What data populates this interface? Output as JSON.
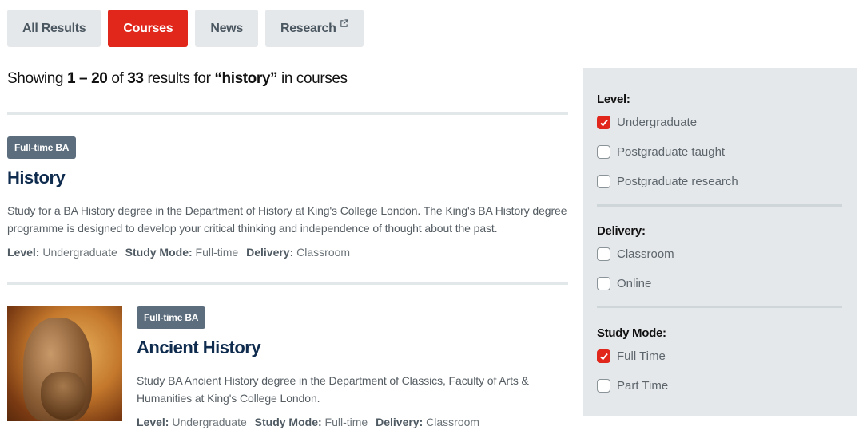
{
  "tabs": [
    {
      "label": "All Results",
      "active": false
    },
    {
      "label": "Courses",
      "active": true
    },
    {
      "label": "News",
      "active": false
    },
    {
      "label": "Research",
      "active": false,
      "icon": "external-link-icon"
    }
  ],
  "summary": {
    "prefix": "Showing",
    "range": "1 – 20",
    "of": "of",
    "total": "33",
    "results_for": "results for",
    "query": "“history”",
    "suffix": "in courses"
  },
  "results": [
    {
      "badge": "Full-time BA",
      "title": "History",
      "description": "Study for a BA History degree in the Department of History at King's College London. The King's BA History degree programme is designed to develop your critical thinking and independence of thought about the past.",
      "meta": [
        {
          "key": "Level:",
          "value": "Undergraduate"
        },
        {
          "key": "Study Mode:",
          "value": "Full-time"
        },
        {
          "key": "Delivery:",
          "value": "Classroom"
        }
      ]
    },
    {
      "badge": "Full-time BA",
      "title": "Ancient History",
      "description": "Study BA Ancient History degree in the Department of Classics, Faculty of Arts & Humanities at King's College London.",
      "image": "classical-bust-image",
      "meta": [
        {
          "key": "Level:",
          "value": "Undergraduate"
        },
        {
          "key": "Study Mode:",
          "value": "Full-time"
        },
        {
          "key": "Delivery:",
          "value": "Classroom"
        }
      ]
    }
  ],
  "filters": {
    "level": {
      "heading": "Level:",
      "options": [
        {
          "label": "Undergraduate",
          "checked": true
        },
        {
          "label": "Postgraduate taught",
          "checked": false
        },
        {
          "label": "Postgraduate research",
          "checked": false
        }
      ]
    },
    "delivery": {
      "heading": "Delivery:",
      "options": [
        {
          "label": "Classroom",
          "checked": false
        },
        {
          "label": "Online",
          "checked": false
        }
      ]
    },
    "study_mode": {
      "heading": "Study Mode:",
      "options": [
        {
          "label": "Full Time",
          "checked": true
        },
        {
          "label": "Part Time",
          "checked": false
        }
      ]
    }
  },
  "colors": {
    "accent": "#e1261c",
    "title": "#0f2c4f",
    "badge": "#5c6e7e",
    "panel": "#e5e8ea"
  }
}
